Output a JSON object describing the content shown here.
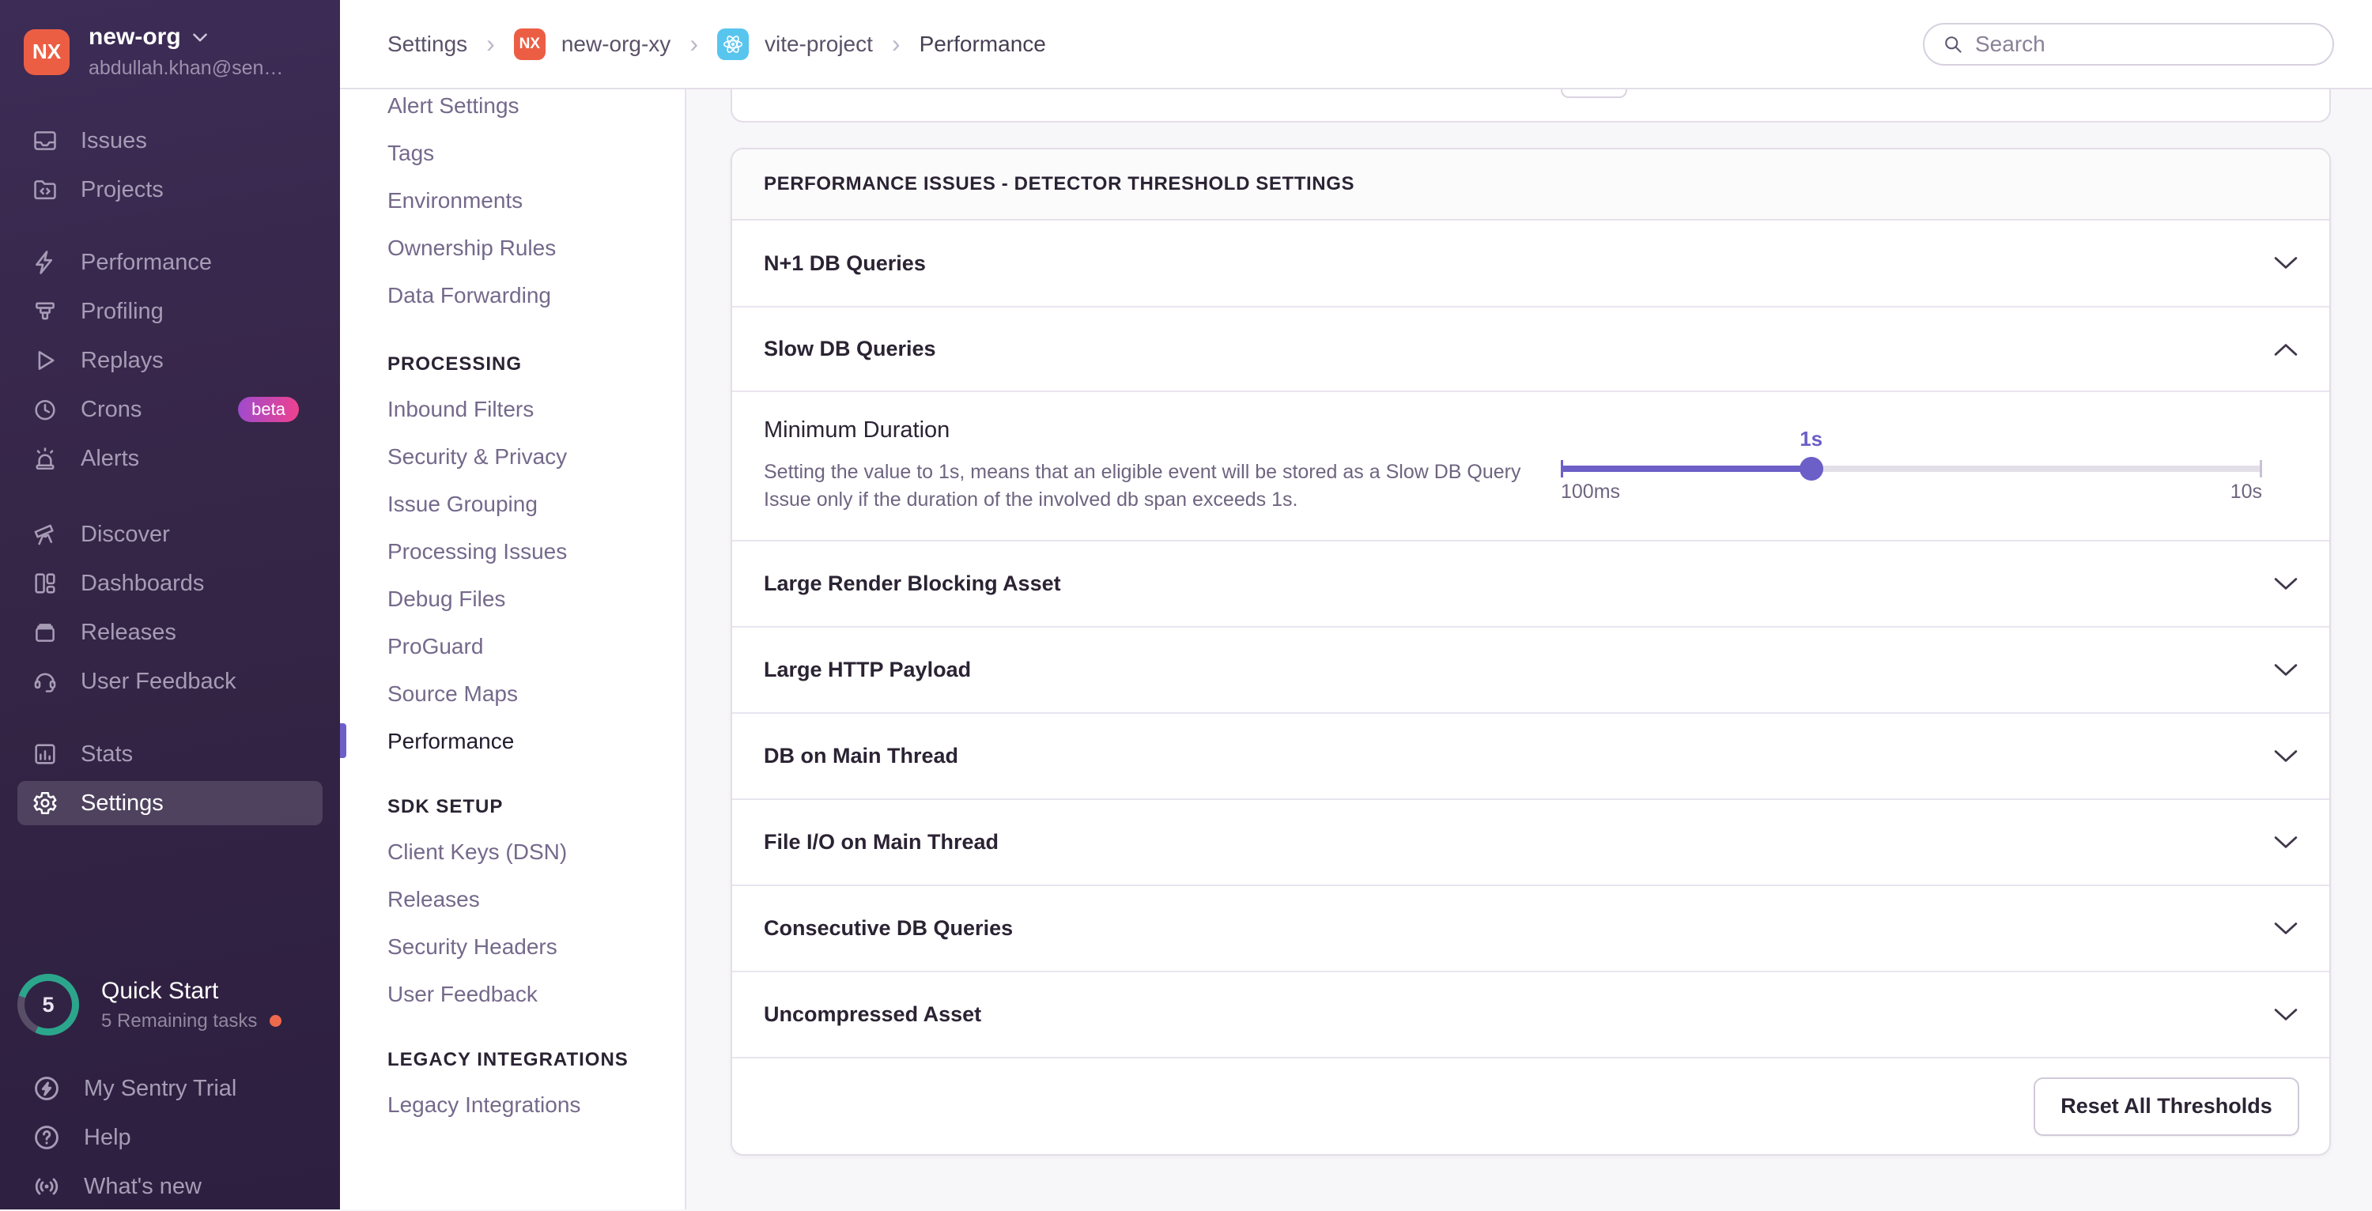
{
  "colors": {
    "accent": "#6c5fc7",
    "orange": "#ec5e44",
    "teal": "#2ba68c",
    "beta_from": "#9e4bce",
    "beta_to": "#f0418e",
    "react_blue": "#58c5ee"
  },
  "org": {
    "initials": "NX",
    "name": "new-org",
    "email": "abdullah.khan@sen…"
  },
  "sidebar": {
    "items": [
      {
        "label": "Issues"
      },
      {
        "label": "Projects"
      },
      {
        "label": "Performance"
      },
      {
        "label": "Profiling"
      },
      {
        "label": "Replays"
      },
      {
        "label": "Crons",
        "badge": "beta"
      },
      {
        "label": "Alerts"
      },
      {
        "label": "Discover"
      },
      {
        "label": "Dashboards"
      },
      {
        "label": "Releases"
      },
      {
        "label": "User Feedback"
      },
      {
        "label": "Stats"
      },
      {
        "label": "Settings"
      }
    ]
  },
  "quick_start": {
    "count": "5",
    "title": "Quick Start",
    "subtitle": "5 Remaining tasks"
  },
  "sidebar_footer": {
    "items": [
      {
        "label": "My Sentry Trial"
      },
      {
        "label": "Help"
      },
      {
        "label": "What's new"
      }
    ]
  },
  "breadcrumb": {
    "settings": "Settings",
    "org_initials": "NX",
    "org": "new-org-xy",
    "project": "vite-project",
    "page": "Performance",
    "separator": "›"
  },
  "search": {
    "placeholder": "Search"
  },
  "settings_nav": {
    "groups": [
      {
        "items": [
          {
            "label": "Alert Settings"
          },
          {
            "label": "Tags"
          },
          {
            "label": "Environments"
          },
          {
            "label": "Ownership Rules"
          },
          {
            "label": "Data Forwarding"
          }
        ]
      },
      {
        "header": "PROCESSING",
        "items": [
          {
            "label": "Inbound Filters"
          },
          {
            "label": "Security & Privacy"
          },
          {
            "label": "Issue Grouping"
          },
          {
            "label": "Processing Issues"
          },
          {
            "label": "Debug Files"
          },
          {
            "label": "ProGuard"
          },
          {
            "label": "Source Maps"
          },
          {
            "label": "Performance",
            "active": true
          }
        ]
      },
      {
        "header": "SDK SETUP",
        "items": [
          {
            "label": "Client Keys (DSN)"
          },
          {
            "label": "Releases"
          },
          {
            "label": "Security Headers"
          },
          {
            "label": "User Feedback"
          }
        ]
      },
      {
        "header": "LEGACY INTEGRATIONS",
        "items": [
          {
            "label": "Legacy Integrations"
          }
        ]
      }
    ]
  },
  "panel": {
    "title": "PERFORMANCE ISSUES - DETECTOR THRESHOLD SETTINGS",
    "rows": [
      {
        "label": "N+1 DB Queries"
      },
      {
        "label": "Slow DB Queries",
        "expanded": true
      },
      {
        "label": "Large Render Blocking Asset"
      },
      {
        "label": "Large HTTP Payload"
      },
      {
        "label": "DB on Main Thread"
      },
      {
        "label": "File I/O on Main Thread"
      },
      {
        "label": "Consecutive DB Queries"
      },
      {
        "label": "Uncompressed Asset"
      }
    ],
    "detector": {
      "heading": "Minimum Duration",
      "description": "Setting the value to 1s, means that an eligible event will be stored as a Slow DB Query Issue only if the duration of the involved db span exceeds 1s.",
      "value_label": "1s",
      "min_label": "100ms",
      "max_label": "10s",
      "percent": 35.7
    },
    "reset_label": "Reset All Thresholds"
  }
}
